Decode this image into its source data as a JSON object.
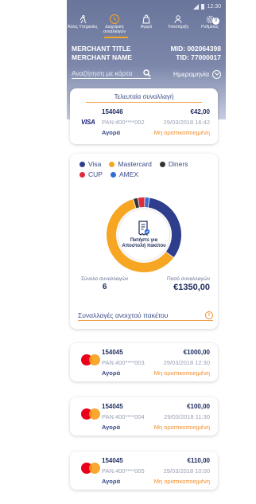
{
  "status_bar": {
    "time": "12:30"
  },
  "nav": {
    "items": [
      {
        "label": "Άλλες Υπηρεσίες",
        "icon": "runner-icon"
      },
      {
        "label": "Διαχείριση συναλλαγών",
        "icon": "clock-icon",
        "active": true
      },
      {
        "label": "Αγορά",
        "icon": "bag-icon"
      },
      {
        "label": "Υποστήριξη",
        "icon": "support-icon"
      },
      {
        "label": "Ρυθμίσεις",
        "icon": "gear-icon",
        "badge": "9"
      }
    ]
  },
  "merchant": {
    "title": "MERCHANT TITLE",
    "name": "MERCHANT NAME",
    "mid": "MID: 002064398",
    "tid": "TID: 77000017"
  },
  "search": {
    "placeholder": "Αναζήτηση με κάρτα"
  },
  "date_filter": {
    "label": "Ημερομηνία"
  },
  "last_transaction": {
    "title": "Τελευταία συναλλαγή",
    "card_brand": "VISA",
    "id": "154046",
    "amount": "€42,00",
    "pan": "PAN:400****002",
    "date": "29/03/2018 16:42",
    "type": "Αγορά",
    "status": "Μη οριστικοποιημένη"
  },
  "package": {
    "legend": [
      {
        "label": "Visa",
        "color": "#2e3d8c"
      },
      {
        "label": "Mastercard",
        "color": "#f6a623"
      },
      {
        "label": "Diners",
        "color": "#333333"
      },
      {
        "label": "CUP",
        "color": "#e02b3c"
      },
      {
        "label": "AMEX",
        "color": "#2f6fd6"
      }
    ],
    "send_label": "Πατήστε για Αποστολή πακέτου",
    "total_count_label": "Σύνολο συναλλαγών",
    "total_count": "6",
    "total_amount_label": "Ποσό συναλλαγών",
    "total_amount": "€1350,00",
    "open_label": "Συναλλαγές ανοιχτού πακέτου"
  },
  "chart_data": {
    "type": "pie",
    "categories": [
      "Visa",
      "Mastercard",
      "Diners",
      "CUP",
      "AMEX"
    ],
    "values": [
      33,
      60,
      2,
      3,
      2
    ]
  },
  "transactions": [
    {
      "card_brand": "mastercard",
      "id": "154045",
      "amount": "€1000,00",
      "pan": "PAN:400****003",
      "date": "29/03/2018 12:30",
      "type": "Αγορά",
      "status": "Μη οριστικοποιημένη"
    },
    {
      "card_brand": "mastercard",
      "id": "154045",
      "amount": "€100,00",
      "pan": "PAN:400****004",
      "date": "29/03/2018 11:30",
      "type": "Αγορά",
      "status": "Μη οριστικοποιημένη"
    },
    {
      "card_brand": "mastercard",
      "id": "154045",
      "amount": "€110,00",
      "pan": "PAN:400****005",
      "date": "29/03/2018 10:00",
      "type": "Αγορά",
      "status": "Μη οριστικοποιημένη"
    }
  ]
}
